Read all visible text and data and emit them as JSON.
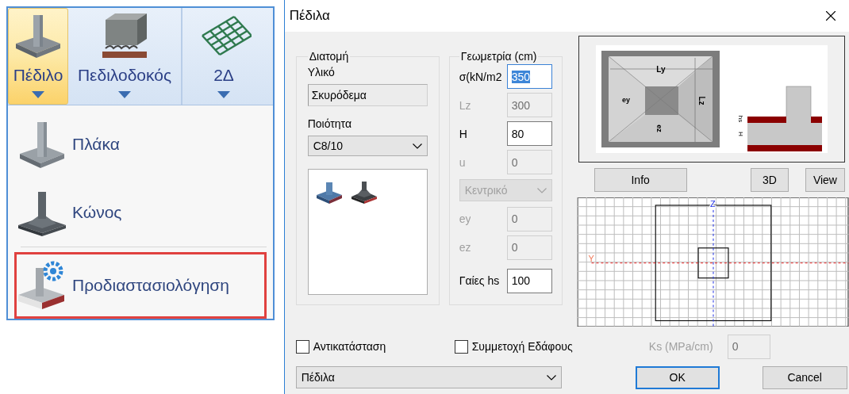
{
  "ribbon": {
    "buttons": [
      {
        "label": "Πέδιλο",
        "selected": true,
        "kind": "footing"
      },
      {
        "label": "Πεδιλοδοκός",
        "selected": false,
        "kind": "beam"
      },
      {
        "label": "2Δ",
        "selected": false,
        "kind": "mesh"
      }
    ]
  },
  "menu": {
    "items": [
      {
        "label": "Πλάκα",
        "highlighted": false,
        "kind": "slab"
      },
      {
        "label": "Κώνος",
        "highlighted": false,
        "kind": "cone"
      },
      {
        "label": "Προδιαστασιολόγηση",
        "highlighted": true,
        "kind": "predesign"
      }
    ]
  },
  "dialog": {
    "title": "Πέδιλα",
    "section": {
      "title": "Διατομή",
      "material_label": "Υλικό",
      "material": "Σκυρόδεμα",
      "quality_label": "Ποιότητα",
      "quality": "C8/10",
      "types": [
        {
          "kind": "plate"
        },
        {
          "kind": "cone"
        }
      ]
    },
    "geometry": {
      "title": "Γεωμετρία (cm)",
      "rows": [
        {
          "kind": "field",
          "label": "σ(kN/m2",
          "value": "350",
          "disabled": false,
          "focused": true
        },
        {
          "kind": "field",
          "label": "Lz",
          "value": "300",
          "disabled": true,
          "focused": false
        },
        {
          "kind": "field",
          "label": "H",
          "value": "80",
          "disabled": false,
          "focused": false
        },
        {
          "kind": "field",
          "label": "u",
          "value": "0",
          "disabled": true,
          "focused": false
        },
        {
          "kind": "select",
          "value": "Κεντρικό",
          "disabled": true
        },
        {
          "kind": "field",
          "label": "ey",
          "value": "0",
          "disabled": true,
          "focused": false
        },
        {
          "kind": "field",
          "label": "ez",
          "value": "0",
          "disabled": true,
          "focused": false
        },
        {
          "kind": "field",
          "label": "Γαίες hs",
          "value": "100",
          "disabled": false,
          "focused": false
        }
      ]
    },
    "preview": {
      "ly": "Ly",
      "ey": "ey",
      "lz": "Lz",
      "ez": "ez",
      "h": "H",
      "hs": "hs"
    },
    "view_buttons": [
      "Info",
      "3D",
      "View"
    ],
    "grid": {
      "y_label": "Y",
      "z_label": "Z"
    },
    "options": [
      {
        "label": "Αντικατάσταση",
        "checked": false
      },
      {
        "label": "Συμμετοχή Εδάφους",
        "checked": false
      }
    ],
    "ks": {
      "label": "Ks (MPa/cm)",
      "value": "0",
      "disabled": true
    },
    "type_select": "Πέδιλα",
    "buttons": [
      {
        "label": "OK",
        "default": true
      },
      {
        "label": "Cancel",
        "default": false
      }
    ]
  }
}
